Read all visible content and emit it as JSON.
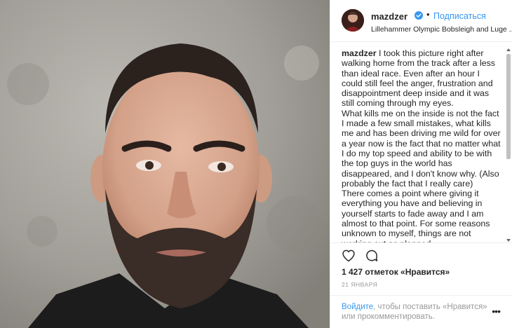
{
  "post": {
    "photo_alt": ""
  },
  "header": {
    "username": "mazdzer",
    "dot": "•",
    "follow_label": "Подписаться",
    "location": "Lillehammer Olympic Bobsleigh and Luge ..."
  },
  "caption": {
    "username": "mazdzer",
    "paragraphs": [
      " I took this picture right after walking home from the track after a less than ideal race. Even after an hour I could still feel the anger, frustration and disappointment deep inside and it was still coming through my eyes.",
      "What kills me on the inside is not the fact I made a few small mistakes, what kills me and has been driving me wild for over a year now is the fact that no matter what I do my top speed and ability to be with the top guys in the world has disappeared, and I don't know why. (Also probably the fact that I really care)",
      "There comes a point where giving it everything you have and believing in yourself starts to fade away and I am almost to that point. For some reasons unknown to myself, things are not working out as planned."
    ]
  },
  "stats": {
    "likes": "1 427 отметок «Нравится»",
    "date": "21 ЯНВАРЯ"
  },
  "login": {
    "link": "Войдите",
    "text": ", чтобы поставить «Нравится» или прокомментировать.",
    "more": "•••"
  },
  "colors": {
    "accent": "#3897f0",
    "text": "#262626",
    "muted": "#999999",
    "border": "#efefef"
  },
  "icons": {
    "verified": "verified-badge-icon",
    "like": "heart-outline-icon",
    "comment": "speech-bubble-icon",
    "more": "ellipsis-icon"
  }
}
